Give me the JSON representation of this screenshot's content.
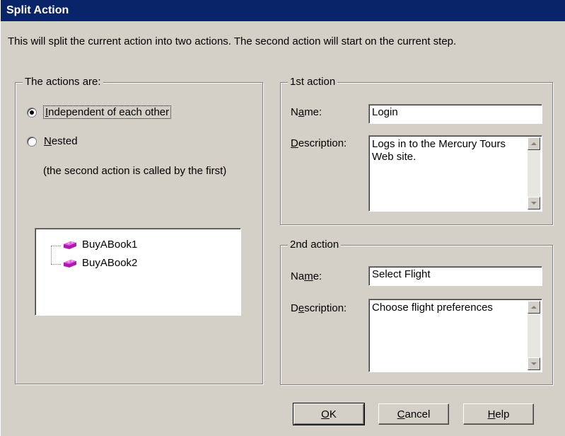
{
  "window": {
    "title": "Split Action"
  },
  "intro_text": "This will split the current action into two actions. The second action will start on the current step.",
  "actions_group": {
    "legend": "The actions are:",
    "options": [
      {
        "label": "Independent of each other",
        "selected": true
      },
      {
        "label": "Nested",
        "selected": false
      }
    ],
    "nested_hint": "(the second action is called by the first)",
    "tree_items": [
      "BuyABook1",
      "BuyABook2"
    ]
  },
  "first_action": {
    "legend": "1st action",
    "name_label": "Name:",
    "name_value": "Login",
    "description_label": "Description:",
    "description_value": "Logs in to the Mercury Tours Web site."
  },
  "second_action": {
    "legend": "2nd action",
    "name_label": "Name:",
    "name_value": "Select Flight",
    "description_label": "Description:",
    "description_value": "Choose flight preferences"
  },
  "buttons": {
    "ok": "OK",
    "cancel": "Cancel",
    "help": "Help"
  },
  "colors": {
    "titlebar": "#0a246a",
    "face": "#d4d0c8",
    "action_icon": "#c020c0"
  },
  "icons": {
    "action": "action-block-icon"
  }
}
